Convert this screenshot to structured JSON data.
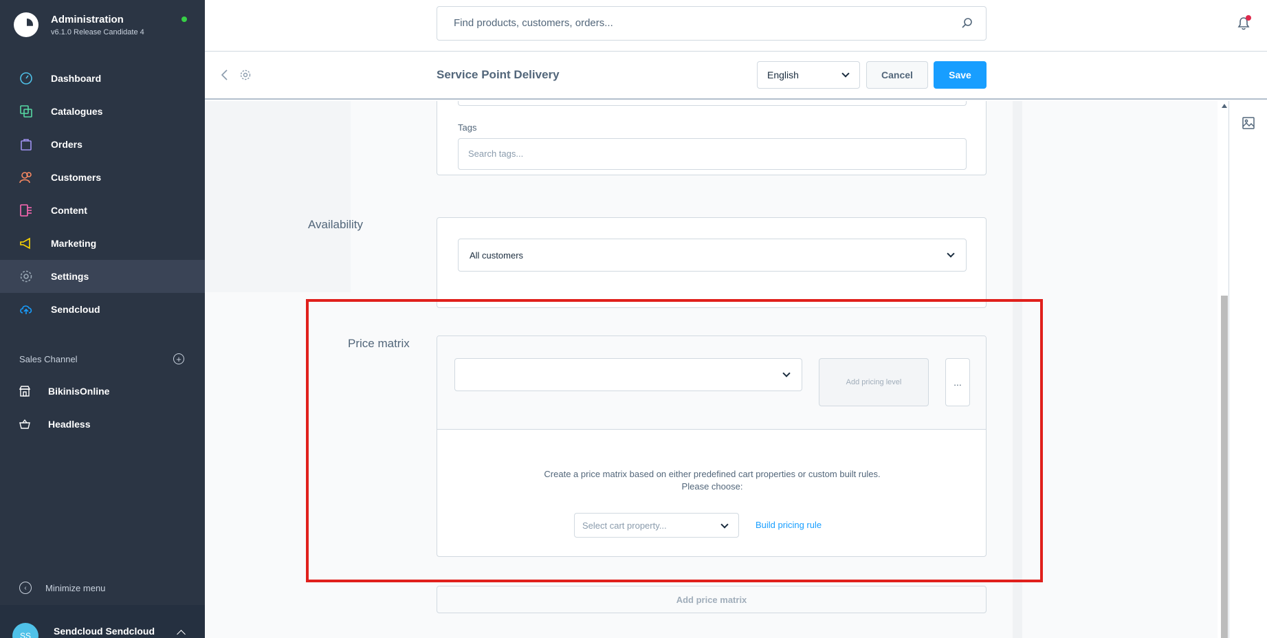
{
  "sidebar": {
    "brand_title": "Administration",
    "brand_version": "v6.1.0 Release Candidate 4",
    "status_color": "#37d046",
    "items": [
      {
        "label": "Dashboard",
        "icon": "dashboard-icon",
        "color": "#4fc1e8"
      },
      {
        "label": "Catalogues",
        "icon": "catalogues-icon",
        "color": "#57d9a3"
      },
      {
        "label": "Orders",
        "icon": "orders-icon",
        "color": "#a092f0"
      },
      {
        "label": "Customers",
        "icon": "customers-icon",
        "color": "#f88962"
      },
      {
        "label": "Content",
        "icon": "content-icon",
        "color": "#ff68b4"
      },
      {
        "label": "Marketing",
        "icon": "marketing-icon",
        "color": "#ffd700"
      },
      {
        "label": "Settings",
        "icon": "settings-icon",
        "color": "#9aa8b5"
      },
      {
        "label": "Sendcloud",
        "icon": "sendcloud-icon",
        "color": "#189eff"
      }
    ],
    "sales_channel_heading": "Sales Channel",
    "sales_channels": [
      {
        "label": "BikinisOnline",
        "icon": "storefront-icon"
      },
      {
        "label": "Headless",
        "icon": "basket-icon"
      }
    ],
    "minimize_label": "Minimize menu",
    "user_initials": "SS",
    "user_name": "Sendcloud Sendcloud"
  },
  "topbar": {
    "search_placeholder": "Find products, customers, orders..."
  },
  "smartbar": {
    "title": "Service Point Delivery",
    "language": "English",
    "cancel_label": "Cancel",
    "save_label": "Save",
    "save_color": "#189eff"
  },
  "form": {
    "tags_label": "Tags",
    "tags_placeholder": "Search tags...",
    "availability_label": "Availability",
    "availability_value": "All customers",
    "price_matrix_label": "Price matrix",
    "add_pricing_level": "Add pricing level",
    "more_label": "...",
    "empty_text": "Create a price matrix based on either predefined cart properties or custom built rules. Please choose:",
    "cart_property_placeholder": "Select cart property...",
    "build_pricing_rule": "Build pricing rule",
    "add_price_matrix": "Add price matrix"
  },
  "highlight_color": "#e0201c"
}
